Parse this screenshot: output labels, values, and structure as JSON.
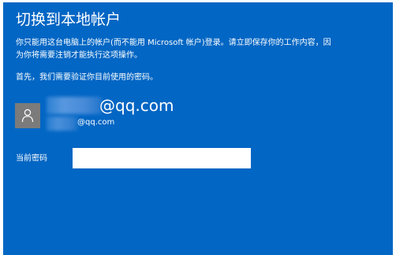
{
  "dialog": {
    "title": "切换到本地帐户",
    "description_lines": [
      "你只能用这台电脑上的帐户(而不能用 Microsoft 帐户)登录。请立即保存你的工作内容，因",
      "为你将需要注销才能执行这项操作。"
    ],
    "verify_prompt": "首先，我们需要验证你目前使用的密码。",
    "account": {
      "primary_text": "@qq.com",
      "secondary_text": "@qq.com",
      "avatar_icon": "user-icon"
    },
    "password": {
      "label": "当前密码",
      "value": ""
    }
  },
  "colors": {
    "background": "#0266c4",
    "avatar": "#7b7b7b",
    "text": "#ffffff",
    "input": "#ffffff"
  }
}
